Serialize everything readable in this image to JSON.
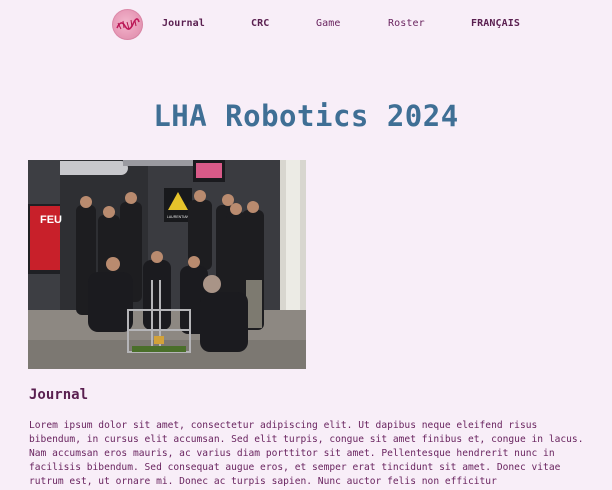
{
  "nav": {
    "logo_icon": "team-logo-icon",
    "items": [
      {
        "label": "Journal",
        "bold": true
      },
      {
        "label": "CRC",
        "bold": true
      },
      {
        "label": "Game",
        "bold": false
      },
      {
        "label": "Roster",
        "bold": false
      },
      {
        "label": "FRANÇAIS",
        "bold": true
      }
    ]
  },
  "page": {
    "title": "LHA Robotics 2024"
  },
  "photo": {
    "banner_text": "FEU",
    "sign_text": "LAURENTIAN"
  },
  "journal": {
    "heading": "Journal",
    "body": "Lorem ipsum dolor sit amet, consectetur adipiscing elit. Ut dapibus neque eleifend risus bibendum, in cursus elit accumsan. Sed elit turpis, congue sit amet finibus et, congue in lacus. Nam accumsan eros mauris, ac varius diam porttitor sit amet. Pellentesque hendrerit nunc in facilisis bibendum. Sed consequat augue eros, et semper erat tincidunt sit amet. Donec vitae rutrum est, ut ornare mi. Donec ac turpis sapien. Nunc auctor felis non efficitur"
  },
  "colors": {
    "background": "#f8eef8",
    "title": "#3f6f95",
    "text": "#6a2560"
  }
}
